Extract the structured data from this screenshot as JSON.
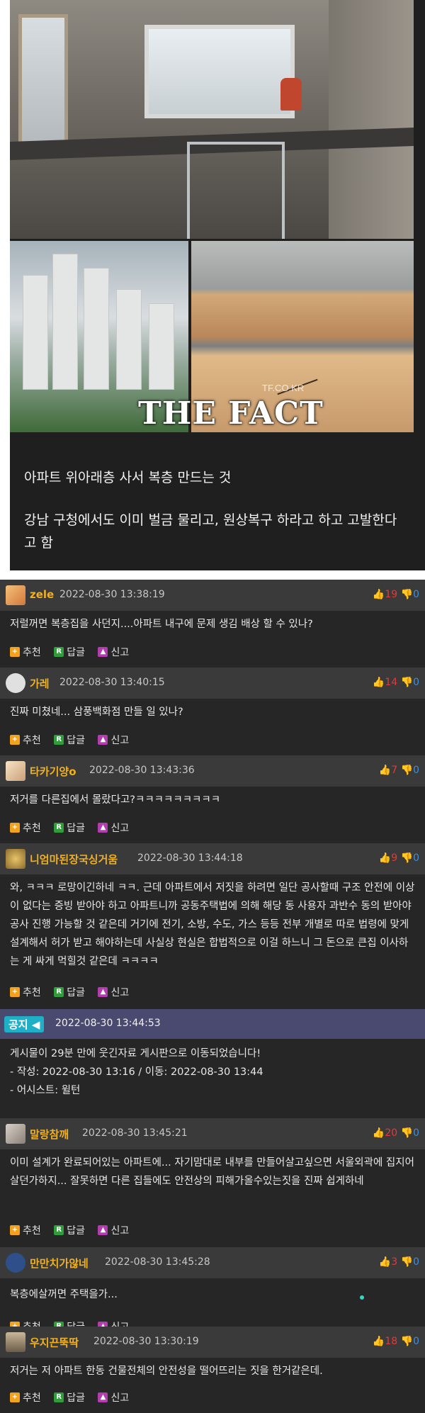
{
  "post": {
    "watermark_site": "TF.CO.KR",
    "watermark": "THE FACT",
    "caption_line1": "아파트 위아래층 사서 복층 만드는 것",
    "caption_line2": "강남 구청에서도 이미 벌금 물리고, 원상복구 하라고 하고 고발한다고 함"
  },
  "labels": {
    "recommend": "추천",
    "reply": "답글",
    "report": "신고",
    "reply_icon": "R"
  },
  "comments": [
    {
      "name": "zele",
      "time": "2022-08-30 13:38:19",
      "up": "19",
      "down": "0",
      "text": "저럴꺼면 복층집을 사던지....아파트 내구에 문제 생김 배상 할 수 있나?"
    },
    {
      "name": "가레",
      "time": "2022-08-30 13:40:15",
      "up": "14",
      "down": "0",
      "text": "진짜 미쳤네... 삼풍백화점 만들 일 있나?"
    },
    {
      "name": "타카기양o",
      "time": "2022-08-30 13:43:36",
      "up": "7",
      "down": "0",
      "text": "저거를 다른집에서 몰랐다고?ㅋㅋㅋㅋㅋㅋㅋㅋㅋ"
    },
    {
      "name": "니엄마된장국싱거움",
      "time": "2022-08-30 13:44:18",
      "up": "9",
      "down": "0",
      "text": "와, ㅋㅋㅋ 로망이긴하네 ㅋㅋ. 근데 아파트에서 저짓을 하려면 일단 공사할때 구조 안전에 이상이 없다는 증빙 받아야 하고 아파트니까 공동주택법에 의해 해당 동 사용자 과반수 동의 받아야 공사 진행 가능할 것 같은데 거기에 전기, 소방, 수도, 가스 등등 전부 개별로 따로 법령에 맞게 설계해서 허가 받고 해야하는데 사실상 현실은 합법적으로 이걸 하느니 그 돈으로 큰집 이사하는 게 싸게 먹힐것 같은데 ㅋㅋㅋㅋ"
    },
    {
      "name": "말랑참깨",
      "time": "2022-08-30 13:45:21",
      "up": "20",
      "down": "0",
      "text": "이미 설계가 완료되어있는 아파트에... 자기맘대로 내부를 만들어살고싶으면 서울외곽에 집지어 살던가하지... 잘못하면 다른 집들에도 안전상의 피해가올수있는짓을 진짜 쉽게하네"
    },
    {
      "name": "만만치가않네",
      "time": "2022-08-30 13:45:28",
      "up": "3",
      "down": "0",
      "text": "복층에살꺼면 주택을가..."
    },
    {
      "name": "우지끈뚝딱",
      "time": "2022-08-30 13:30:19",
      "up": "18",
      "down": "0",
      "text": "저거는 저 아파트 한동 건물전체의 안전성을 떨어뜨리는 짓을 한거같은데."
    }
  ],
  "notice": {
    "badge": "공지",
    "time": "2022-08-30 13:44:53",
    "line1": "게시물이 29분 만에 웃긴자료 게시판으로 이동되었습니다!",
    "line2": "- 작성: 2022-08-30 13:16 / 이동: 2022-08-30 13:44",
    "line3": "- 어시스트: 윌턴"
  },
  "colors": {
    "name": "#f0b020",
    "up": "#e03b3b",
    "down": "#3b8fe0",
    "notice_bar": "#4a4a70"
  }
}
